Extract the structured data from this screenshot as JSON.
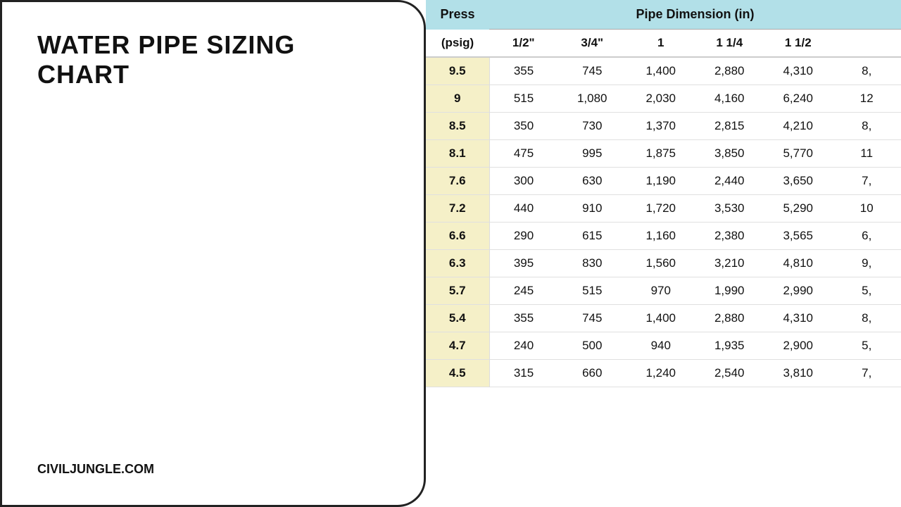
{
  "left": {
    "title": "WATER PIPE SIZING CHART",
    "url": "CIVILJUNGLE.COM"
  },
  "table": {
    "mainHeader": {
      "press": "Press",
      "pipeDim": "Pipe Dimension (in)"
    },
    "subHeader": {
      "pressUnit": "(psig)",
      "cols": [
        "1/2\"",
        "3/4\"",
        "1",
        "1 1/4",
        "1 1/2",
        ""
      ]
    },
    "rows": [
      {
        "press": "9.5",
        "vals": [
          "355",
          "745",
          "1,400",
          "2,880",
          "4,310",
          "8,"
        ]
      },
      {
        "press": "9",
        "vals": [
          "515",
          "1,080",
          "2,030",
          "4,160",
          "6,240",
          "12"
        ]
      },
      {
        "press": "8.5",
        "vals": [
          "350",
          "730",
          "1,370",
          "2,815",
          "4,210",
          "8,"
        ]
      },
      {
        "press": "8.1",
        "vals": [
          "475",
          "995",
          "1,875",
          "3,850",
          "5,770",
          "11"
        ]
      },
      {
        "press": "7.6",
        "vals": [
          "300",
          "630",
          "1,190",
          "2,440",
          "3,650",
          "7,"
        ]
      },
      {
        "press": "7.2",
        "vals": [
          "440",
          "910",
          "1,720",
          "3,530",
          "5,290",
          "10"
        ]
      },
      {
        "press": "6.6",
        "vals": [
          "290",
          "615",
          "1,160",
          "2,380",
          "3,565",
          "6,"
        ]
      },
      {
        "press": "6.3",
        "vals": [
          "395",
          "830",
          "1,560",
          "3,210",
          "4,810",
          "9,"
        ]
      },
      {
        "press": "5.7",
        "vals": [
          "245",
          "515",
          "970",
          "1,990",
          "2,990",
          "5,"
        ]
      },
      {
        "press": "5.4",
        "vals": [
          "355",
          "745",
          "1,400",
          "2,880",
          "4,310",
          "8,"
        ]
      },
      {
        "press": "4.7",
        "vals": [
          "240",
          "500",
          "940",
          "1,935",
          "2,900",
          "5,"
        ]
      },
      {
        "press": "4.5",
        "vals": [
          "315",
          "660",
          "1,240",
          "2,540",
          "3,810",
          "7,"
        ]
      }
    ]
  }
}
